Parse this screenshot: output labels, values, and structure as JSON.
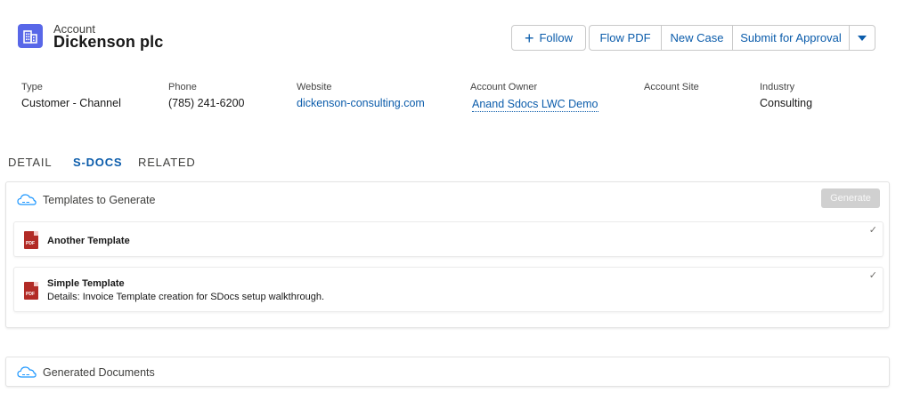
{
  "header": {
    "object_label": "Account",
    "record_name": "Dickenson plc",
    "icon": "building-icon",
    "accent_color": "#5867e8"
  },
  "actions": {
    "follow_label": "Follow",
    "buttons": [
      "Flow PDF",
      "New Case",
      "Submit for Approval"
    ],
    "menu_icon": "chevron-down-icon"
  },
  "fields": [
    {
      "label": "Type",
      "value": "Customer - Channel"
    },
    {
      "label": "Phone",
      "value": "(785) 241-6200"
    },
    {
      "label": "Website",
      "value": "dickenson-consulting.com"
    },
    {
      "label": "Account Owner",
      "value": "Anand Sdocs LWC Demo"
    },
    {
      "label": "Account Site",
      "value": ""
    },
    {
      "label": "Industry",
      "value": "Consulting"
    }
  ],
  "tabs": [
    "DETAIL",
    "S-DOCS",
    "RELATED"
  ],
  "active_tab": "S-DOCS",
  "templates_card": {
    "title": "Templates to Generate",
    "generate_label": "Generate",
    "items": [
      {
        "name": "Another Template",
        "detail": "",
        "file_type": "PDF"
      },
      {
        "name": "Simple Template",
        "detail": "Details: Invoice Template creation for SDocs setup walkthrough.",
        "file_type": "PDF"
      }
    ]
  },
  "generated_card": {
    "title": "Generated Documents"
  }
}
